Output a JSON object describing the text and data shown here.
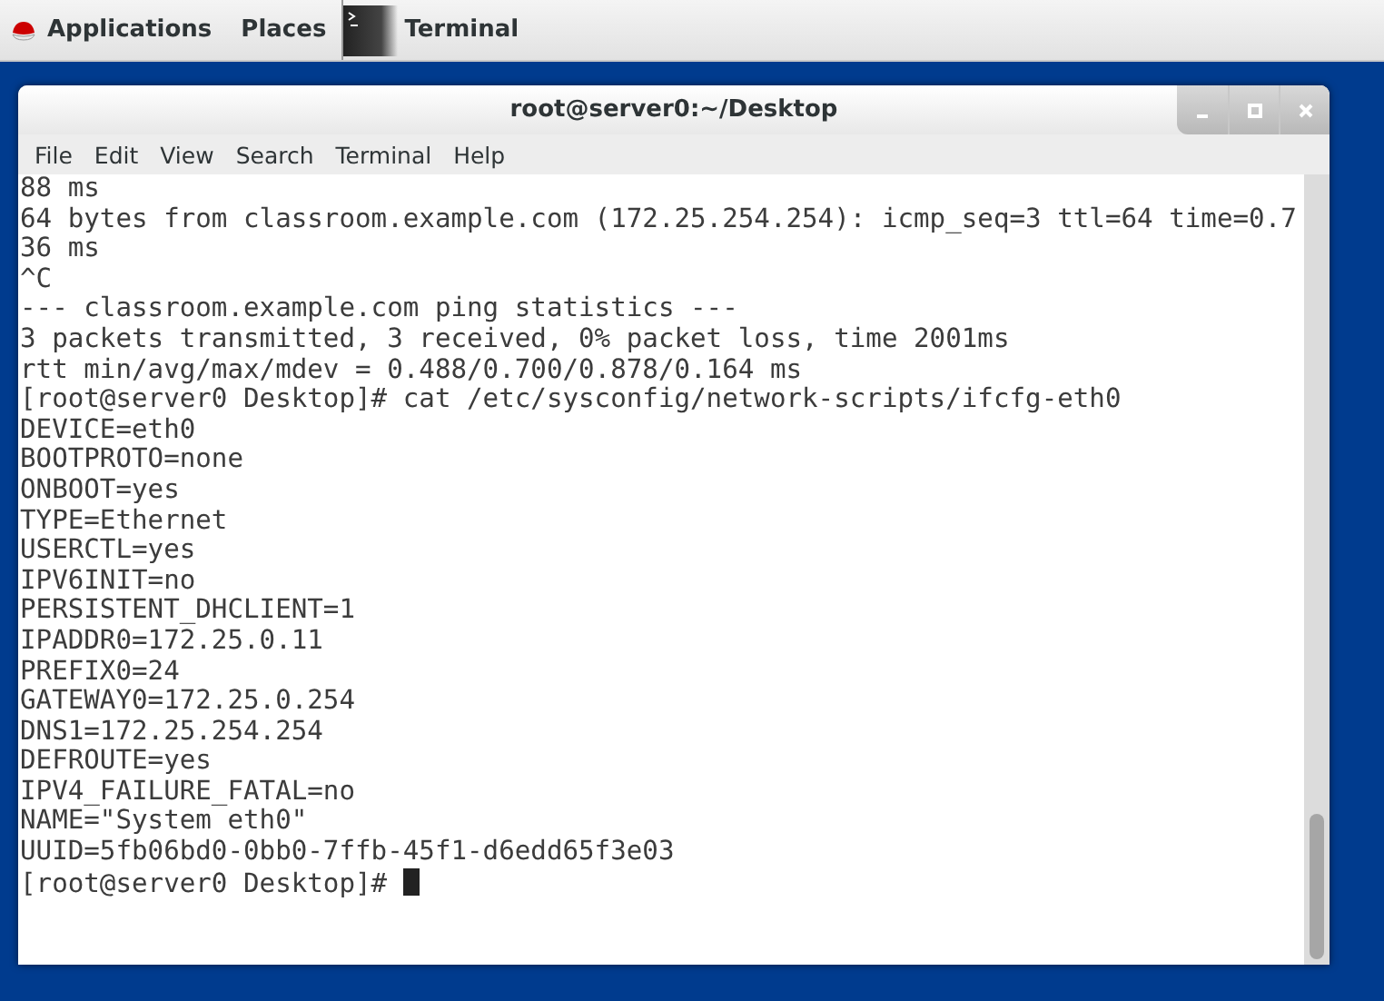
{
  "top_bar": {
    "menus": [
      "Applications",
      "Places"
    ],
    "task": "Terminal"
  },
  "window": {
    "title": "root@server0:~/Desktop"
  },
  "menu_bar": [
    "File",
    "Edit",
    "View",
    "Search",
    "Terminal",
    "Help"
  ],
  "terminal": {
    "lines": [
      "88 ms",
      "64 bytes from classroom.example.com (172.25.254.254): icmp_seq=3 ttl=64 time=0.7",
      "36 ms",
      "^C",
      "--- classroom.example.com ping statistics ---",
      "3 packets transmitted, 3 received, 0% packet loss, time 2001ms",
      "rtt min/avg/max/mdev = 0.488/0.700/0.878/0.164 ms",
      "[root@server0 Desktop]# cat /etc/sysconfig/network-scripts/ifcfg-eth0",
      "DEVICE=eth0",
      "BOOTPROTO=none",
      "ONBOOT=yes",
      "TYPE=Ethernet",
      "USERCTL=yes",
      "IPV6INIT=no",
      "PERSISTENT_DHCLIENT=1",
      "IPADDR0=172.25.0.11",
      "PREFIX0=24",
      "GATEWAY0=172.25.0.254",
      "DNS1=172.25.254.254",
      "DEFROUTE=yes",
      "IPV4_FAILURE_FATAL=no",
      "NAME=\"System eth0\"",
      "UUID=5fb06bd0-0bb0-7ffb-45f1-d6edd65f3e03"
    ],
    "prompt": "[root@server0 Desktop]#"
  }
}
